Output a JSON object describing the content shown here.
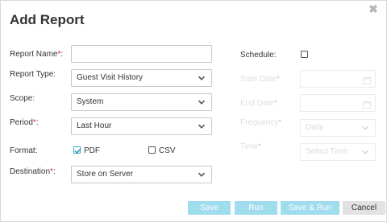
{
  "dialog": {
    "title": "Add Report",
    "close_glyph": "✖"
  },
  "form": {
    "report_name": {
      "label": "Report Name",
      "required_mark": "*",
      "suffix": ":",
      "value": ""
    },
    "report_type": {
      "label": "Report Type:",
      "value": "Guest Visit History"
    },
    "scope": {
      "label": "Scope:",
      "value": "System"
    },
    "period": {
      "label": "Period",
      "required_mark": "*",
      "suffix": ":",
      "value": "Last Hour"
    },
    "format": {
      "label": "Format:",
      "options": [
        {
          "label": "PDF",
          "checked": true
        },
        {
          "label": "CSV",
          "checked": false
        }
      ]
    },
    "destination": {
      "label": "Destination",
      "required_mark": "*",
      "suffix": ":",
      "value": "Store on Server"
    }
  },
  "schedule": {
    "label": "Schedule:",
    "checked": false,
    "start_date": {
      "label": "Start Date",
      "required_mark": "*",
      "value": ""
    },
    "end_date": {
      "label": "End Date",
      "required_mark": "*",
      "value": ""
    },
    "frequency": {
      "label": "Frequency",
      "required_mark": "*",
      "value": "Daily"
    },
    "time": {
      "label": "Time",
      "required_mark": "*",
      "placeholder": "Select Time"
    }
  },
  "buttons": {
    "save": "Save",
    "run": "Run",
    "save_run": "Save & Run",
    "cancel": "Cancel"
  },
  "colors": {
    "accent": "#39a7c8",
    "primary_button_disabled": "#9fdcee",
    "required": "#e02424"
  },
  "icons": [
    "close-icon",
    "chevron-down-icon",
    "calendar-icon",
    "checkmark-icon"
  ]
}
